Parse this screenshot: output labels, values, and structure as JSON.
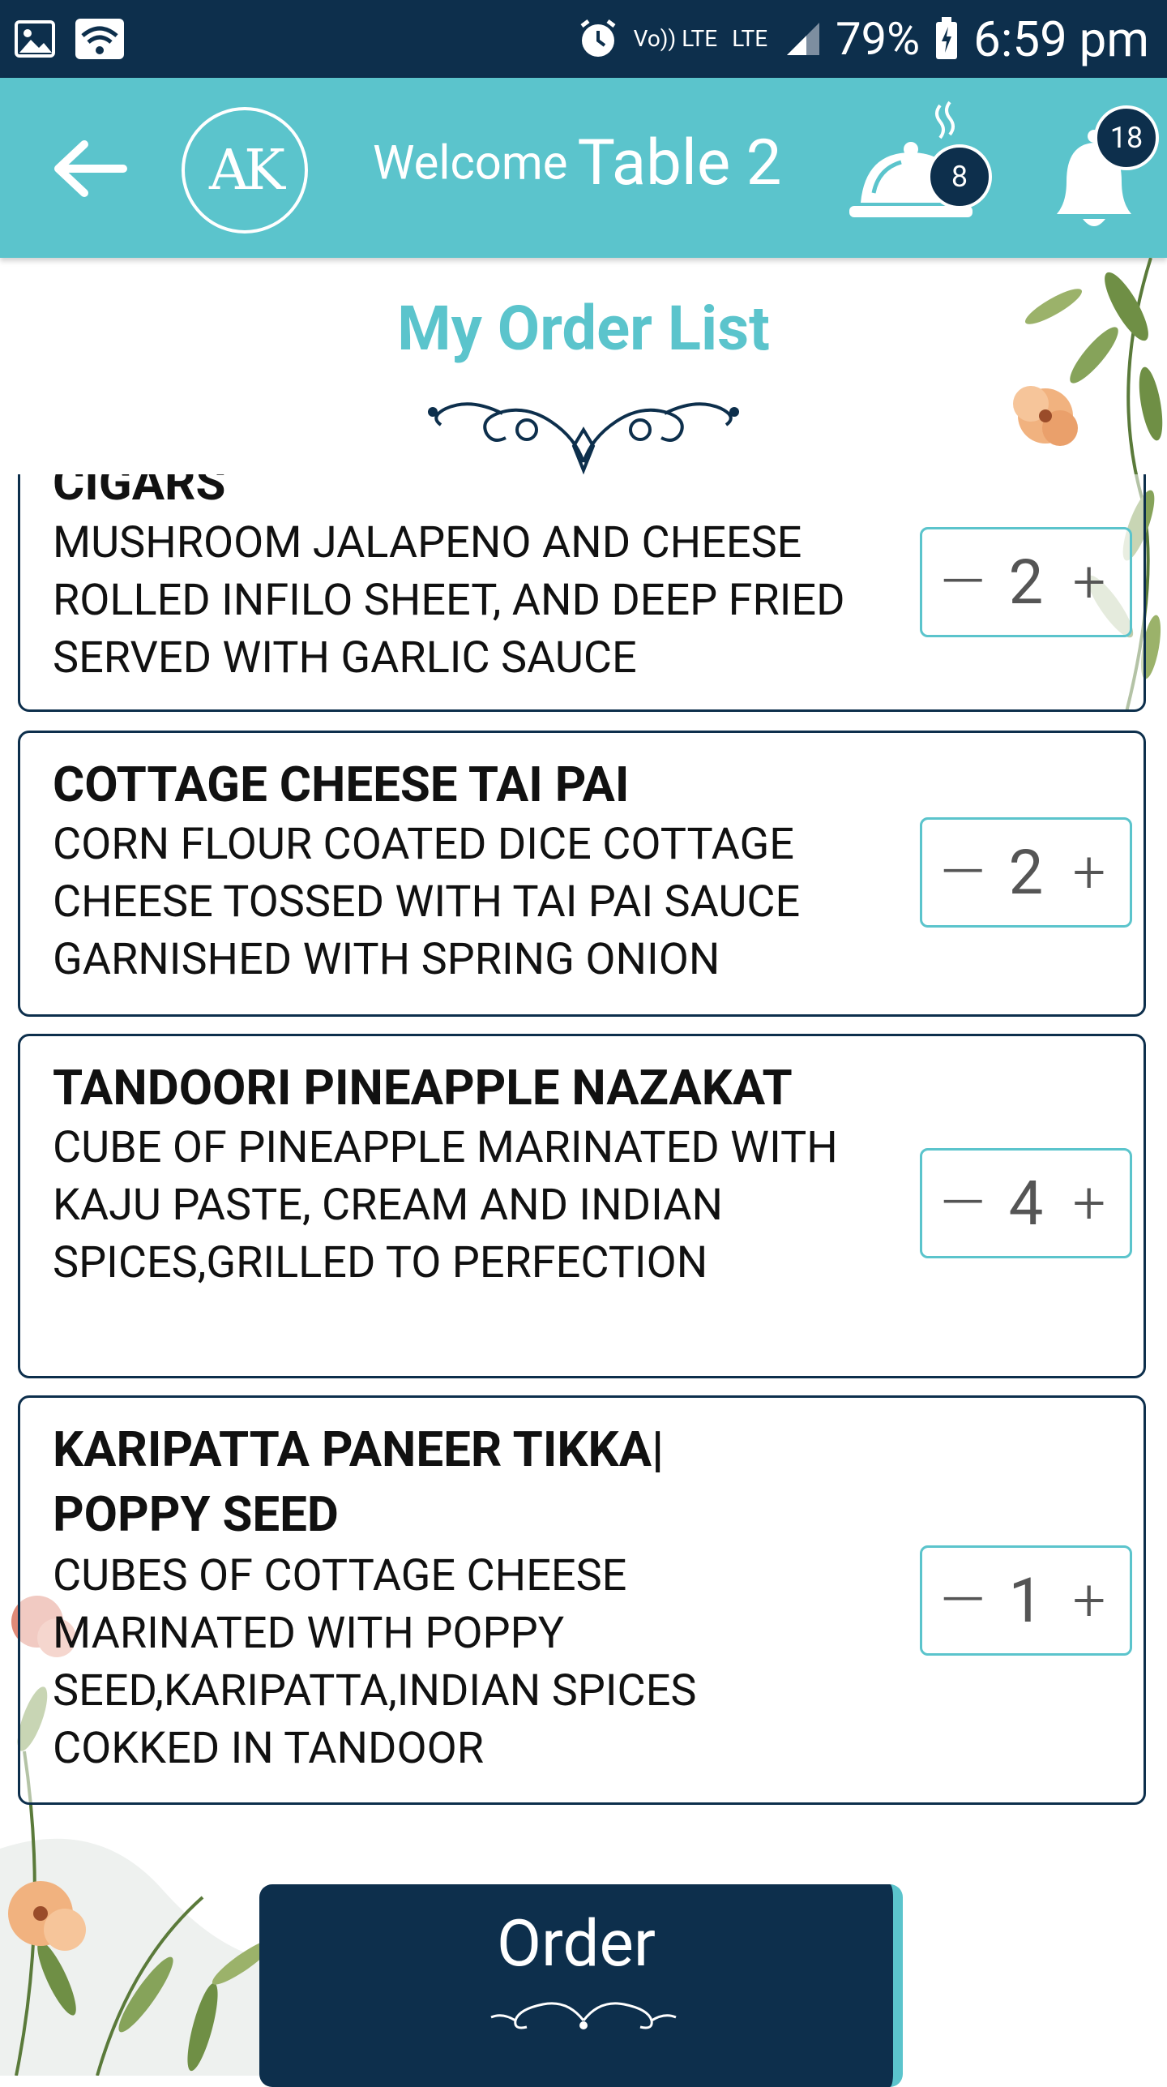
{
  "status_bar": {
    "volte": "Vo)) LTE",
    "lte": "LTE",
    "battery": "79%",
    "time": "6:59 pm"
  },
  "header": {
    "logo_text": "AK",
    "welcome_label": "Welcome",
    "table_label": "Table 2",
    "orders_badge": "8",
    "notifications_badge": "18"
  },
  "page": {
    "title": "My Order List"
  },
  "orders": [
    {
      "name": "CIGARS",
      "description": "MUSHROOM JALAPENO AND CHEESE ROLLED INFILO SHEET, AND DEEP FRIED SERVED WITH GARLIC SAUCE",
      "quantity": "2"
    },
    {
      "name": "COTTAGE CHEESE TAI PAI",
      "description": "CORN FLOUR COATED DICE COTTAGE CHEESE TOSSED WITH TAI PAI SAUCE GARNISHED WITH SPRING ONION",
      "quantity": "2"
    },
    {
      "name": "TANDOORI PINEAPPLE NAZAKAT",
      "description": "CUBE OF PINEAPPLE MARINATED WITH KAJU PASTE, CREAM AND INDIAN SPICES,GRILLED TO PERFECTION",
      "quantity": "4"
    },
    {
      "name": "KARIPATTA PANEER TIKKA| POPPY SEED",
      "description": "CUBES OF COTTAGE CHEESE MARINATED WITH POPPY SEED,KARIPATTA,INDIAN SPICES COKKED IN TANDOOR",
      "quantity": "1"
    }
  ],
  "stepper": {
    "minus": "—",
    "plus": "+"
  },
  "order_button": {
    "label": "Order"
  },
  "colors": {
    "primary_dark": "#0d2f4c",
    "accent_teal": "#5bc4cc",
    "text": "#111111"
  },
  "icons": {
    "back": "arrow-left-icon",
    "orders": "cloche-icon",
    "notifications": "bell-icon"
  }
}
